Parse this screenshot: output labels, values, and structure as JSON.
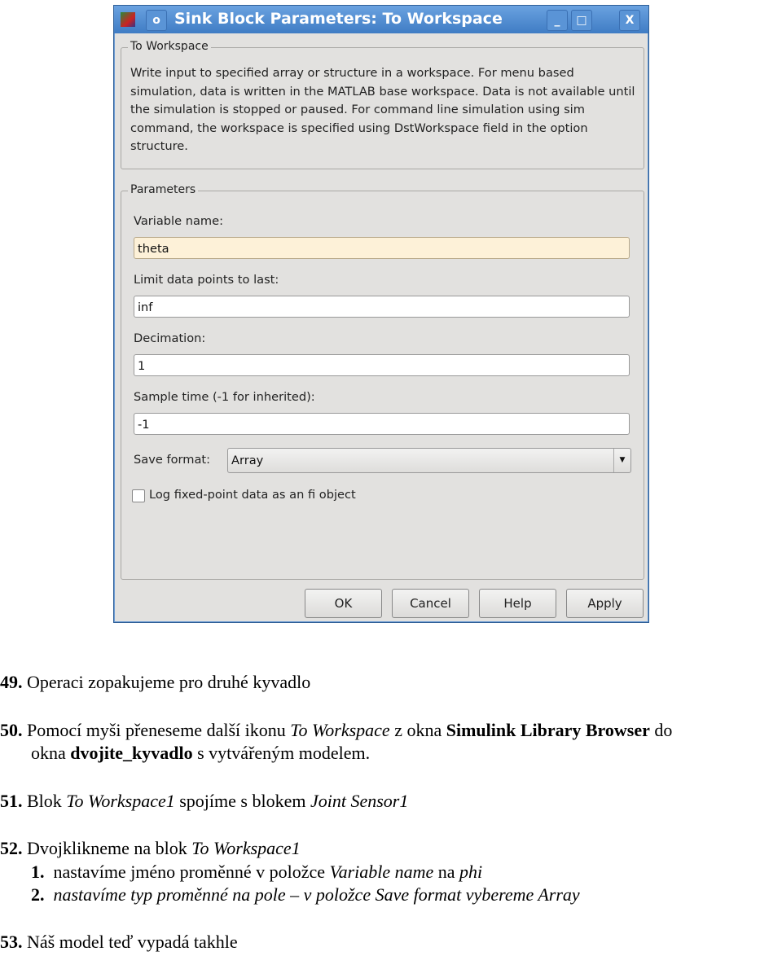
{
  "dialog": {
    "title": "Sink Block Parameters: To Workspace",
    "block_group_label": "To Workspace",
    "description": "Write input to specified array or structure in a workspace. For menu based simulation, data is written in the MATLAB base workspace. Data is not available until the simulation is stopped or paused. For command line simulation using sim command, the workspace is specified using DstWorkspace field in the option structure.",
    "parameters_label": "Parameters",
    "variable_name_label": "Variable name:",
    "variable_name": "theta",
    "limit_label": "Limit data points to last:",
    "limit": "inf",
    "decimation_label": "Decimation:",
    "decimation": "1",
    "sample_time_label": "Sample time (-1 for inherited):",
    "sample_time": "-1",
    "save_format_label": "Save format:",
    "save_format": "Array",
    "log_fi_label": "Log fixed-point data as an fi object",
    "log_fi_checked": false,
    "buttons": {
      "ok": "OK",
      "cancel": "Cancel",
      "help": "Help",
      "apply": "Apply"
    },
    "window_buttons": {
      "minimize": "_",
      "maximize": "□",
      "close": "X"
    }
  },
  "document": {
    "s49": {
      "num": "49.",
      "text": "Operaci zopakujeme pro druhé kyvadlo"
    },
    "s50": {
      "num": "50.",
      "a": "Pomocí myši přeneseme další ikonu ",
      "b": "To Workspace",
      "c": " z okna ",
      "d": "Simulink Library Browser",
      "e": " do",
      "f": "okna ",
      "g": "dvojite_kyvadlo",
      "h": " s vytvářeným modelem."
    },
    "s51": {
      "num": "51.",
      "a": "Blok ",
      "b": "To Workspace1",
      "c": " spojíme s blokem ",
      "d": "Joint Sensor1"
    },
    "s52": {
      "num": "52.",
      "a": "Dvojklikneme na blok ",
      "b": "To Workspace1",
      "i1": {
        "num": "1.",
        "a": "nastavíme jméno proměnné v položce ",
        "b": "Variable name",
        "c": " na ",
        "d": "phi"
      },
      "i2": {
        "num": "2.",
        "a": "nastavíme typ proměnné na pole – v položce Save format vybereme Array"
      }
    },
    "s53": {
      "num": "53.",
      "text": "Náš model teď vypadá takhle"
    }
  },
  "colors": {
    "titlebar": "#3f7cc4",
    "variable_field": "#fdf1d8"
  }
}
